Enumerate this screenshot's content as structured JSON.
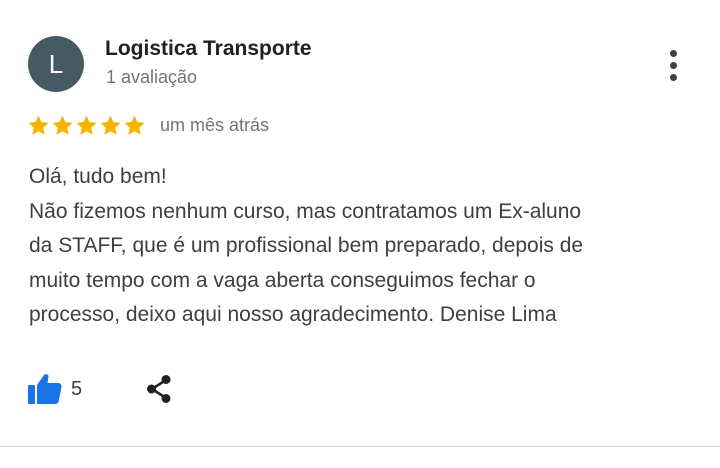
{
  "author": {
    "initial": "L",
    "name": "Logistica Transporte",
    "review_count": "1 avaliação"
  },
  "rating": {
    "stars": 5,
    "max": 5,
    "time_ago": "um mês atrás",
    "star_color": "#f4b400"
  },
  "review": {
    "lines": [
      "Olá, tudo bem!",
      "Não fizemos nenhum curso, mas contratamos um Ex-aluno",
      "da STAFF, que é um profissional bem preparado, depois de",
      "muito tempo com a vaga aberta conseguimos fechar o",
      "processo, deixo aqui nosso agradecimento. Denise Lima"
    ]
  },
  "actions": {
    "like_count": "5",
    "like_icon": "thumbs-up-icon",
    "share_icon": "share-icon",
    "more_icon": "more-vertical-icon",
    "accent_color": "#1a73e8"
  }
}
